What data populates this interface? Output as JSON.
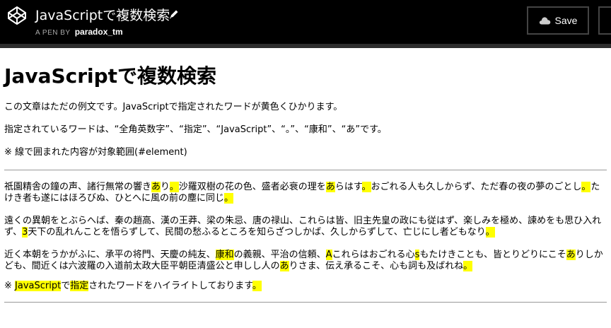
{
  "topbar": {
    "title": "JavaScriptで複数検索",
    "byline_prefix": "A PEN BY",
    "author": "paradox_tm",
    "save_label": "Save"
  },
  "content": {
    "heading": "JavaScriptで複数検索",
    "intro1": "この文章はただの例文です。JavaScriptで指定されたワードが黄色くひかります。",
    "intro2": "指定されているワードは、“全角英数字”、“指定”、“JavaScript”、“。”、“康和”、“あ”です。",
    "intro3": "※ 線で囲まれた内容が対象範囲(#element)",
    "element": {
      "para1": [
        {
          "t": "祇園精舎の鐘の声、諸行無常の響き"
        },
        {
          "t": "あ",
          "h": true
        },
        {
          "t": "り"
        },
        {
          "t": "。",
          "h": true
        },
        {
          "t": "沙羅双樹の花の色、盛者必衰の理を"
        },
        {
          "t": "あ",
          "h": true
        },
        {
          "t": "らはす"
        },
        {
          "t": "。",
          "h": true
        },
        {
          "t": "おごれる人も久しからず、ただ春の夜の夢のごとし"
        },
        {
          "t": "。",
          "h": true
        },
        {
          "t": "たけき者も遂にはほろびぬ、ひとへに風の前の塵に同じ"
        },
        {
          "t": "。",
          "h": true
        }
      ],
      "para2": [
        {
          "t": "遠くの異朝をとぶらへば、秦の趙高、漢の王莽、梁の朱忌、唐の禄山、これらは皆、旧主先皇の政にも従はず、楽しみを極め、諫めをも思ひ入れず、"
        },
        {
          "t": "3",
          "h": true
        },
        {
          "t": "天下の乱れんことを悟らずして、民間の愁ふるところを知らざつしかば、久しからずして、亡じにし者どもなり"
        },
        {
          "t": "。",
          "h": true
        }
      ],
      "para3": [
        {
          "t": "近く本朝をうかがふに、承平の将門、天慶の純友、"
        },
        {
          "t": "康和",
          "h": true
        },
        {
          "t": "の義親、平治の信頼、"
        },
        {
          "t": "A",
          "h": true
        },
        {
          "t": "これらはおごれる心"
        },
        {
          "t": "s",
          "h": true
        },
        {
          "t": "もたけきことも、皆とりどりにこそ"
        },
        {
          "t": "あ",
          "h": true
        },
        {
          "t": "りしかども、間近くは六波羅の入道前太政大臣平朝臣清盛公と申しし人の"
        },
        {
          "t": "あ",
          "h": true
        },
        {
          "t": "りさま、伝え承るこそ、心も詞も及ばれね"
        },
        {
          "t": "。",
          "h": true
        }
      ],
      "para4": [
        {
          "t": "※ "
        },
        {
          "t": "JavaScript",
          "h": true
        },
        {
          "t": "で"
        },
        {
          "t": "指定",
          "h": true
        },
        {
          "t": "されたワードをハイライトしております"
        },
        {
          "t": "。",
          "h": true
        }
      ]
    }
  },
  "colors": {
    "topbar": "#000000",
    "highlight": "#ffff00"
  },
  "icons": {
    "logo": "codepen-logo-icon",
    "edit": "pencil-icon",
    "save": "cloud-icon"
  }
}
